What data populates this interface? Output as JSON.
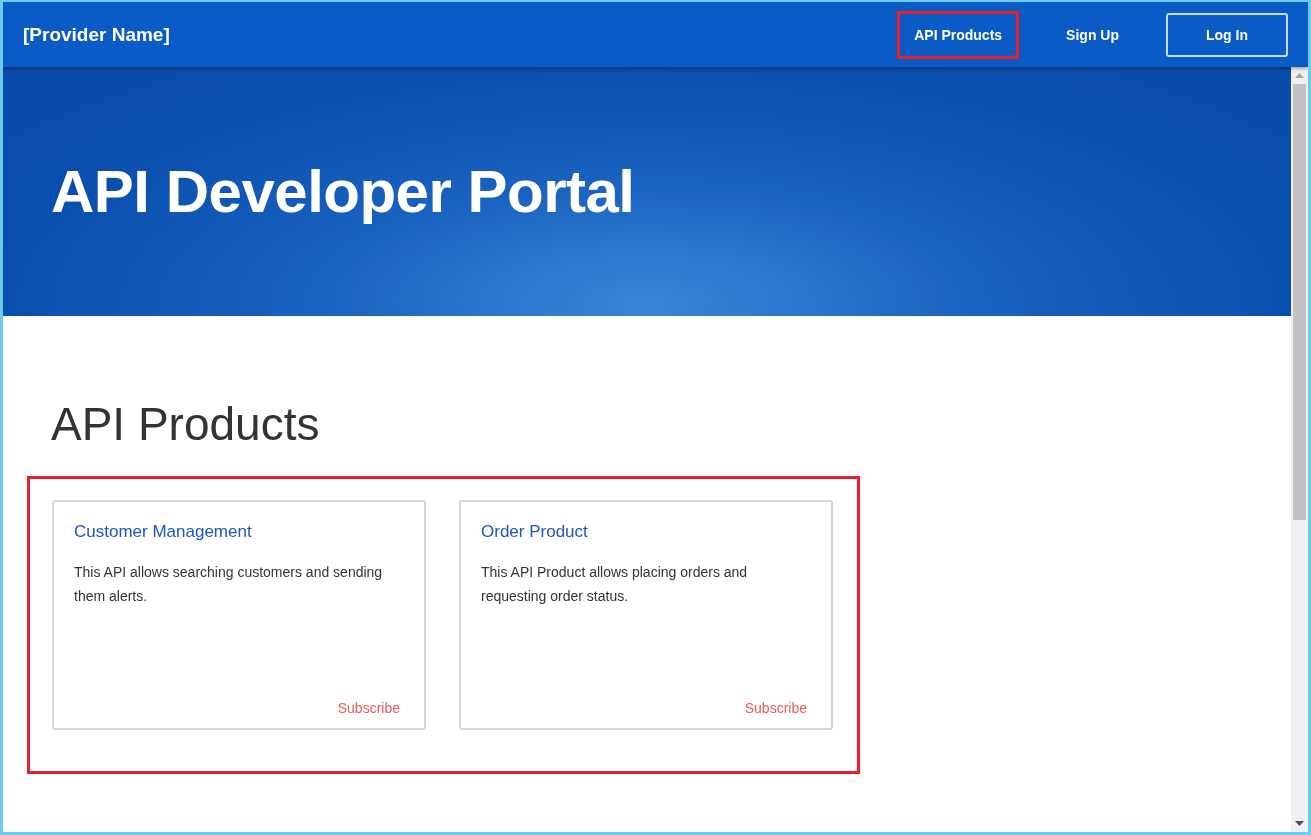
{
  "header": {
    "brand": "[Provider Name]",
    "nav": [
      {
        "label": "API Products",
        "kind": "link",
        "highlighted": true
      },
      {
        "label": "Sign Up",
        "kind": "link",
        "highlighted": false
      },
      {
        "label": "Log In",
        "kind": "outlined",
        "highlighted": false
      }
    ]
  },
  "hero": {
    "title": "API Developer Portal"
  },
  "products": {
    "heading": "API Products",
    "highlighted": true,
    "cards": [
      {
        "title": "Customer Management",
        "description": "This API allows searching customers and sending them alerts.",
        "action": "Subscribe"
      },
      {
        "title": "Order Product",
        "description": "This API Product allows placing orders and requesting order status.",
        "action": "Subscribe"
      }
    ]
  }
}
